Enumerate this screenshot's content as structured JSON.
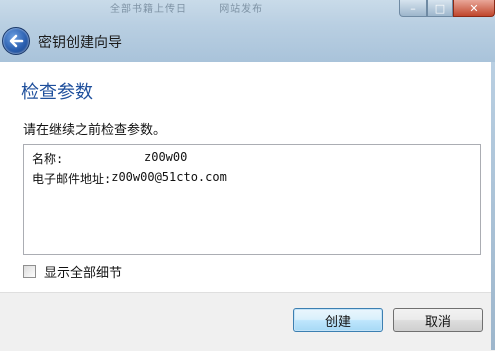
{
  "window": {
    "title": "密钥创建向导",
    "background_tabs": [
      "全部书籍上传日",
      "网站发布"
    ],
    "controls": {
      "minimize": "–",
      "maximize": "□",
      "close": "✕"
    }
  },
  "page": {
    "heading": "检查参数",
    "description": "请在继续之前检查参数。",
    "params": [
      {
        "key": "名称:",
        "value": "z00w00"
      },
      {
        "key": "电子邮件地址:",
        "value": "z00w00@51cto.com"
      }
    ],
    "show_details_label": "显示全部细节",
    "show_details_checked": false
  },
  "buttons": {
    "create": "创建",
    "cancel": "取消"
  },
  "icons": {
    "back": "back-arrow-icon"
  }
}
